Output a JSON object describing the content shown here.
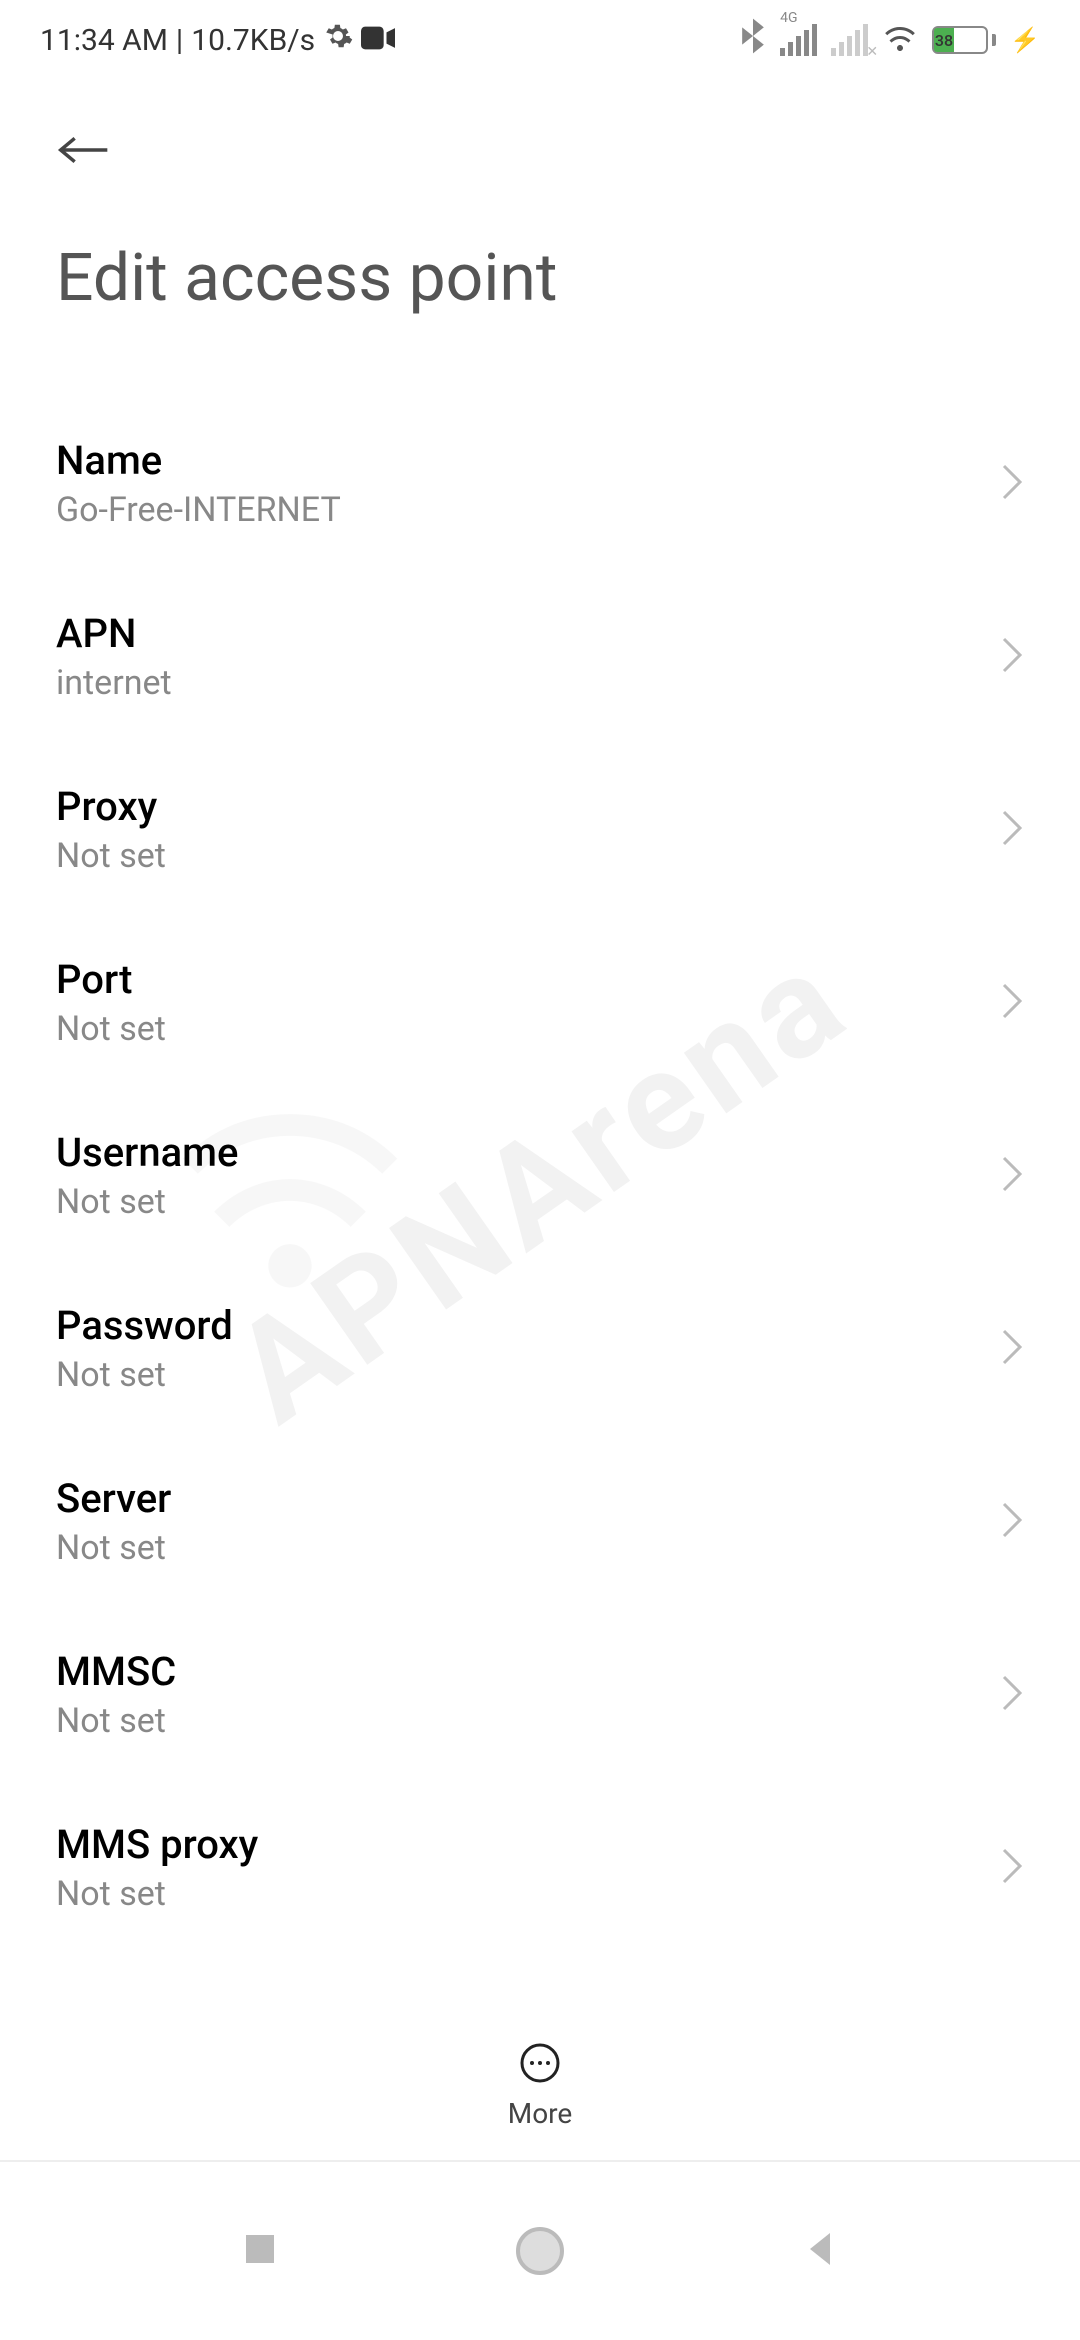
{
  "status": {
    "time": "11:34 AM",
    "separator": "|",
    "data_rate": "10.7KB/s",
    "network_label": "4G",
    "battery_percent": "38"
  },
  "page": {
    "title": "Edit access point"
  },
  "settings": [
    {
      "label": "Name",
      "value": "Go-Free-INTERNET"
    },
    {
      "label": "APN",
      "value": "internet"
    },
    {
      "label": "Proxy",
      "value": "Not set"
    },
    {
      "label": "Port",
      "value": "Not set"
    },
    {
      "label": "Username",
      "value": "Not set"
    },
    {
      "label": "Password",
      "value": "Not set"
    },
    {
      "label": "Server",
      "value": "Not set"
    },
    {
      "label": "MMSC",
      "value": "Not set"
    },
    {
      "label": "MMS proxy",
      "value": "Not set"
    }
  ],
  "actions": {
    "more_label": "More"
  },
  "watermark": {
    "text": "APNArena"
  }
}
